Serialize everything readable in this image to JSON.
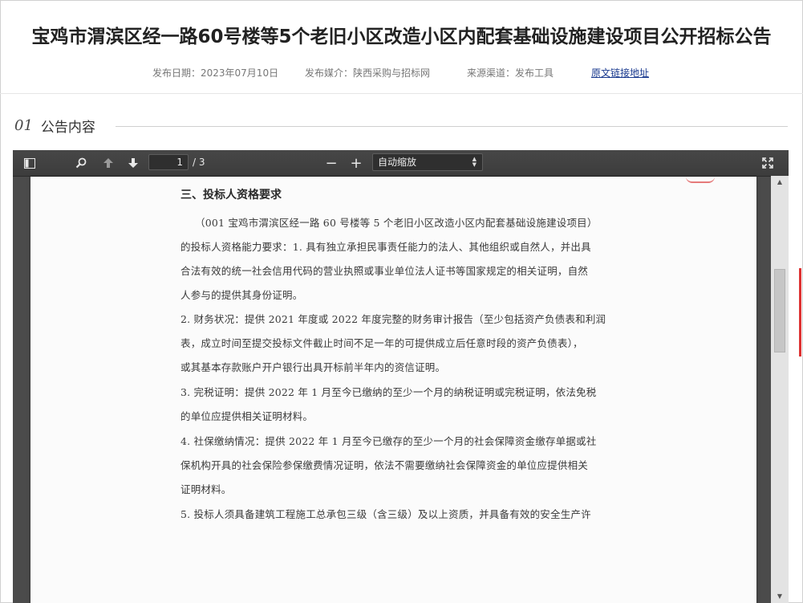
{
  "header": {
    "title": "宝鸡市渭滨区经一路60号楼等5个老旧小区改造小区内配套基础设施建设项目公开招标公告",
    "publish_date": "发布日期：2023年07月10日",
    "publish_media": "发布媒介：陕西采购与招标网",
    "source_channel": "来源渠道：发布工具",
    "original_link": "原文链接地址"
  },
  "section": {
    "number": "01",
    "label": "公告内容"
  },
  "toolbar": {
    "sidebar_icon": "sidebar-toggle-icon",
    "search_icon": "search-icon",
    "prev_icon": "arrow-up-icon",
    "next_icon": "arrow-down-icon",
    "page_current": "1",
    "page_total": "/ 3",
    "zoom_out": "−",
    "zoom_in": "+",
    "zoom_value": "自动缩放",
    "fullscreen_icon": "fullscreen-icon"
  },
  "document": {
    "heading": "三、投标人资格要求",
    "lines": [
      "（001 宝鸡市渭滨区经一路 60 号楼等 5 个老旧小区改造小区内配套基础设施建设项目）",
      "的投标人资格能力要求：1. 具有独立承担民事责任能力的法人、其他组织或自然人，并出具",
      "合法有效的统一社会信用代码的营业执照或事业单位法人证书等国家规定的相关证明，自然",
      "人参与的提供其身份证明。",
      "2. 财务状况：提供 2021 年度或 2022 年度完整的财务审计报告（至少包括资产负债表和利润",
      "表，成立时间至提交投标文件截止时间不足一年的可提供成立后任意时段的资产负债表），",
      "或其基本存款账户开户银行出具开标前半年内的资信证明。",
      "3. 完税证明：提供 2022 年 1 月至今已缴纳的至少一个月的纳税证明或完税证明，依法免税",
      "的单位应提供相关证明材料。",
      "4. 社保缴纳情况：提供 2022 年 1 月至今已缴存的至少一个月的社会保障资金缴存单据或社",
      "保机构开具的社会保险参保缴费情况证明，依法不需要缴纳社会保障资金的单位应提供相关",
      "证明材料。",
      "5. 投标人须具备建筑工程施工总承包三级（含三级）及以上资质，并具备有效的安全生产许"
    ]
  },
  "colors": {
    "toolbar_bg": "#474747",
    "link": "#1a3a8f",
    "page_bg": "#fbfbfb"
  }
}
